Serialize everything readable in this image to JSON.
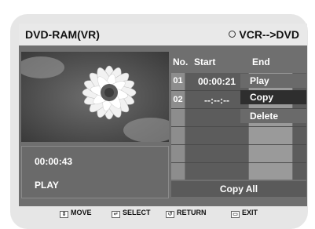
{
  "title": {
    "left": "DVD-RAM(VR)",
    "right": "VCR-->DVD"
  },
  "status": {
    "time": "00:00:43",
    "state": "PLAY"
  },
  "table": {
    "headers": {
      "no": "No.",
      "start": "Start",
      "end": "End"
    },
    "rows": [
      {
        "no": "01",
        "start": "00:00:21"
      },
      {
        "no": "02",
        "start": "--:--:--"
      }
    ]
  },
  "menu": {
    "items": [
      "Play",
      "Copy",
      "Delete"
    ],
    "selected": "Copy"
  },
  "copy_all": "Copy All",
  "footer": {
    "move": "MOVE",
    "select": "SELECT",
    "return": "RETURN",
    "exit": "EXIT"
  }
}
